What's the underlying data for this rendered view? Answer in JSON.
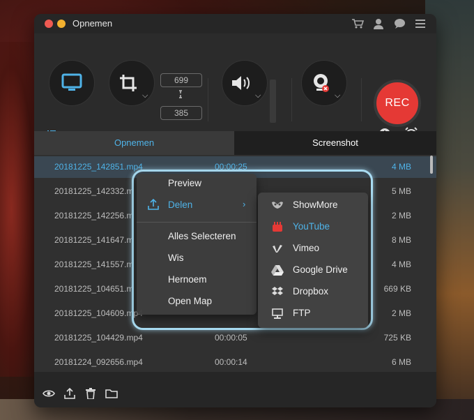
{
  "window": {
    "title": "Opnemen"
  },
  "dimensions": {
    "width": "699",
    "height": "385"
  },
  "rec_label": "REC",
  "tabs": [
    {
      "label": "Opnemen"
    },
    {
      "label": "Screenshot"
    }
  ],
  "recordings": [
    {
      "name": "20181225_142851.mp4",
      "duration": "00:00:25",
      "size": "4 MB",
      "selected": true
    },
    {
      "name": "20181225_142332.m",
      "duration": "",
      "size": "5 MB"
    },
    {
      "name": "20181225_142256.m",
      "duration": "",
      "size": "2 MB"
    },
    {
      "name": "20181225_141647.m",
      "duration": "",
      "size": "8 MB"
    },
    {
      "name": "20181225_141557.m",
      "duration": "",
      "size": "4 MB"
    },
    {
      "name": "20181225_104651.m",
      "duration": "",
      "size": "669 KB"
    },
    {
      "name": "20181225_104609.mp4",
      "duration": "",
      "size": "2 MB"
    },
    {
      "name": "20181225_104429.mp4",
      "duration": "00:00:05",
      "size": "725 KB"
    },
    {
      "name": "20181224_092656.mp4",
      "duration": "00:00:14",
      "size": "6 MB"
    }
  ],
  "context_menu": {
    "items": [
      "Preview",
      "Delen",
      "Alles Selecteren",
      "Wis",
      "Hernoem",
      "Open Map"
    ]
  },
  "share_submenu": {
    "items": [
      "ShowMore",
      "YouTube",
      "Vimeo",
      "Google Drive",
      "Dropbox",
      "FTP"
    ],
    "highlighted": "YouTube"
  },
  "colors": {
    "accent": "#4fb3e8",
    "rec": "#e53935",
    "highlight_border": "#a9dcf2"
  },
  "icons": {
    "title_bar": [
      "cart-icon",
      "user-icon",
      "chat-icon",
      "menu-icon"
    ],
    "bottom_bar": [
      "preview-eye-icon",
      "share-upload-icon",
      "trash-icon",
      "folder-icon"
    ]
  }
}
